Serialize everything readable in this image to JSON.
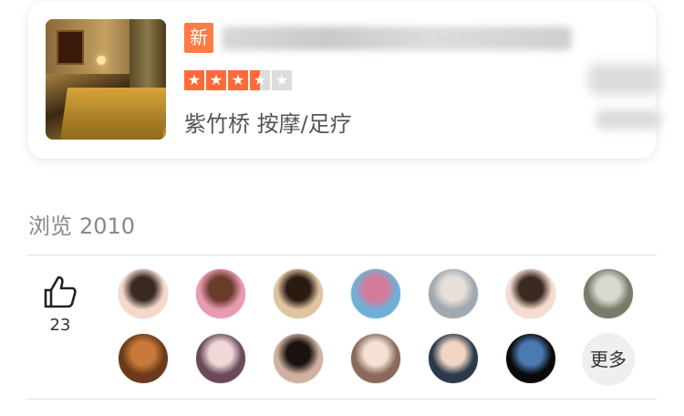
{
  "shop": {
    "new_badge": "新",
    "stars": 3.5,
    "area": "紫竹桥 按摩/足疗"
  },
  "browse": {
    "label": "浏览",
    "count": "2010"
  },
  "likes": {
    "count": "23",
    "icon": "thumbs-up-icon"
  },
  "avatars": [
    {
      "colors": [
        "#f4d8cc",
        "#3a2a22"
      ]
    },
    {
      "colors": [
        "#e89ab0",
        "#6a3a2a"
      ]
    },
    {
      "colors": [
        "#e0c4a0",
        "#2a1a10"
      ]
    },
    {
      "colors": [
        "#6fb0d8",
        "#d47a9a"
      ]
    },
    {
      "colors": [
        "#a0a8b0",
        "#e8e0d8"
      ]
    },
    {
      "colors": [
        "#f6dcd0",
        "#3a2a22"
      ]
    },
    {
      "colors": [
        "#7a7a6a",
        "#d8d8d0"
      ]
    },
    {
      "colors": [
        "#6a3a1a",
        "#c87a3a"
      ]
    },
    {
      "colors": [
        "#6a4a5a",
        "#f0d8d8"
      ]
    },
    {
      "colors": [
        "#d0b0a0",
        "#1a1410"
      ]
    },
    {
      "colors": [
        "#8a6a5a",
        "#f4e0d4"
      ]
    },
    {
      "colors": [
        "#2a3a4a",
        "#f0d4c4"
      ]
    },
    {
      "colors": [
        "#0a0a0a",
        "#4a7ab0"
      ]
    }
  ],
  "more_label": "更多"
}
